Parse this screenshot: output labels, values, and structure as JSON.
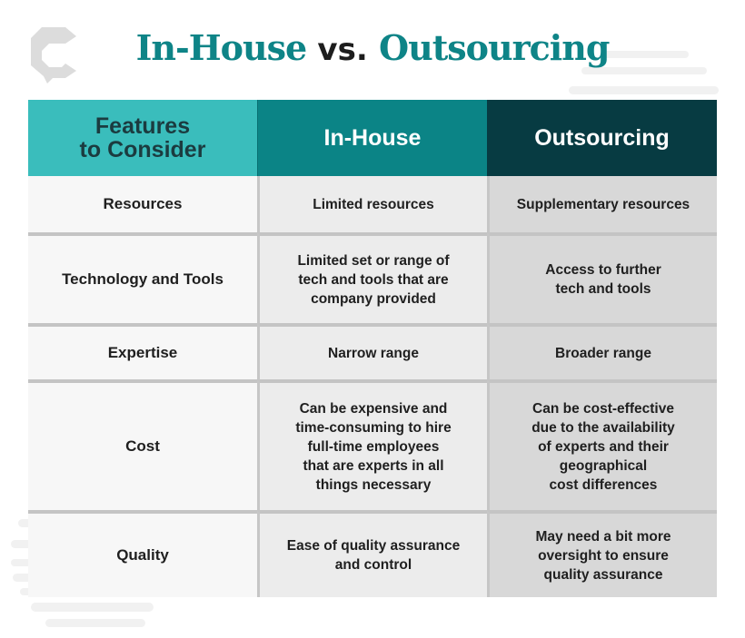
{
  "title": {
    "part1": "In-House",
    "part2": "vs.",
    "part3": "Outsourcing"
  },
  "brand": {
    "logo_icon": "contentwriters-c-logo-icon"
  },
  "colors": {
    "teal_title": "#0e8487",
    "header_features": "#3abdbc",
    "header_inhouse": "#0b8486",
    "header_outsourcing": "#073b42"
  },
  "table": {
    "headers": [
      "Features\nto Consider",
      "In-House",
      "Outsourcing"
    ],
    "rows": [
      {
        "feature": "Resources",
        "inhouse": "Limited resources",
        "outsourcing": "Supplementary resources"
      },
      {
        "feature": "Technology and Tools",
        "inhouse": "Limited set or range of\ntech and tools that are\ncompany provided",
        "outsourcing": "Access to further\ntech and tools"
      },
      {
        "feature": "Expertise",
        "inhouse": "Narrow range",
        "outsourcing": "Broader range"
      },
      {
        "feature": "Cost",
        "inhouse": "Can be expensive and\ntime-consuming to hire\nfull-time employees\nthat are experts in all\nthings necessary",
        "outsourcing": "Can be cost-effective\ndue to the availability\nof experts and their\ngeographical\ncost differences"
      },
      {
        "feature": "Quality",
        "inhouse": "Ease of quality assurance\nand control",
        "outsourcing": "May need a bit more\noversight to ensure\nquality assurance"
      }
    ]
  }
}
